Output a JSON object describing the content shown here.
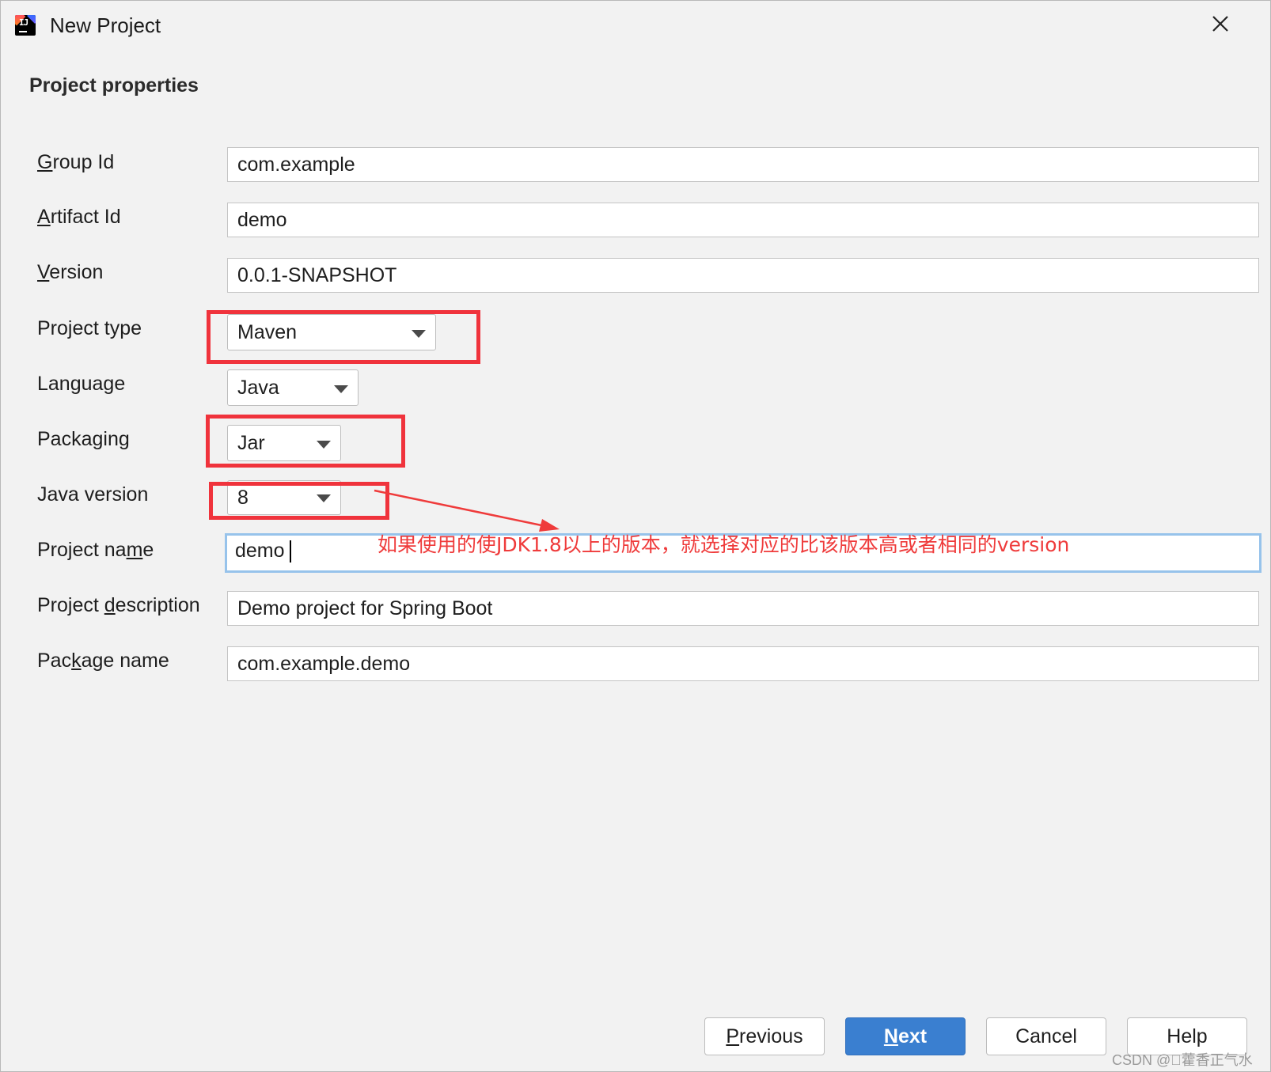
{
  "window": {
    "title": "New Project"
  },
  "section_title": "Project properties",
  "fields": {
    "group_id": {
      "label": "Group Id",
      "mnemonic": "G",
      "label_rest": "roup Id",
      "value": "com.example"
    },
    "artifact_id": {
      "label": "Artifact Id",
      "mnemonic": "A",
      "label_rest": "rtifact Id",
      "value": "demo"
    },
    "version": {
      "label": "Version",
      "mnemonic": "V",
      "label_rest": "ersion",
      "value": "0.0.1-SNAPSHOT"
    },
    "project_type": {
      "label": "Project type",
      "value": "Maven"
    },
    "language": {
      "label": "Language",
      "value": "Java"
    },
    "packaging": {
      "label": "Packaging",
      "value": "Jar"
    },
    "java_version": {
      "label": "Java version",
      "value": "8"
    },
    "project_name": {
      "label": "Project name",
      "label_pre": "Project na",
      "mnemonic": "m",
      "label_post": "e",
      "value": "demo"
    },
    "project_description": {
      "label": "Project description",
      "label_pre": "Project ",
      "mnemonic": "d",
      "label_post": "escription",
      "value": "Demo project for Spring Boot"
    },
    "package_name": {
      "label": "Package name",
      "label_pre": "Pac",
      "mnemonic": "k",
      "label_post": "age name",
      "value": "com.example.demo"
    }
  },
  "annotation": {
    "text": "如果使用的使JDK1.8以上的版本，就选择对应的比该版本高或者相同的version",
    "color": "#ef3b3b"
  },
  "buttons": {
    "previous": {
      "mnemonic": "P",
      "rest": "revious"
    },
    "next": {
      "mnemonic": "N",
      "rest": "ext"
    },
    "cancel": {
      "label": "Cancel"
    },
    "help": {
      "label": "Help"
    }
  },
  "watermark": "CSDN @\u0000藿香正气水",
  "colors": {
    "accent": "#3a7fd0",
    "highlight": "#f0333c",
    "focus_border": "#97c3eb"
  }
}
